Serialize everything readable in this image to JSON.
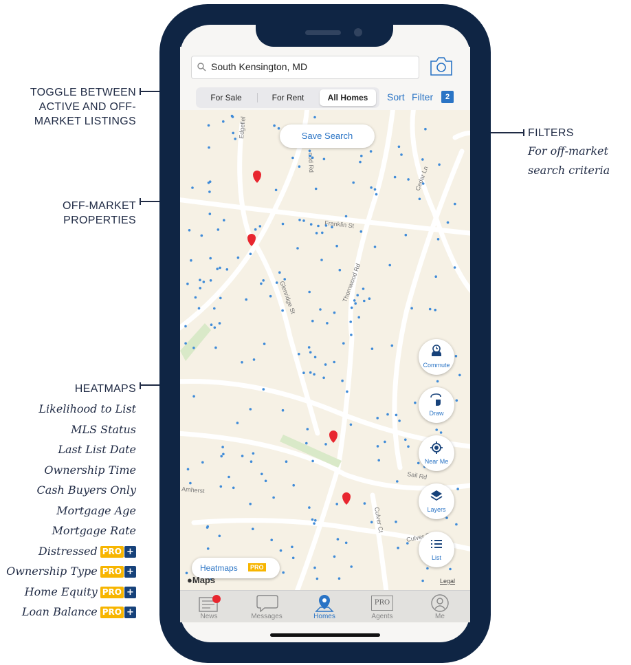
{
  "callouts": {
    "toggle": {
      "line1": "TOGGLE BETWEEN",
      "line2": "ACTIVE AND OFF-",
      "line3": "MARKET LISTINGS"
    },
    "filters": {
      "title": "FILTERS",
      "sub1": "For off-market",
      "sub2": "search criteria"
    },
    "offmarket": {
      "line1": "OFF-MARKET",
      "line2": "PROPERTIES"
    },
    "heatmaps": {
      "title": "HEATMAPS",
      "items": [
        "Likelihood to List",
        "MLS Status",
        "Last List Date",
        "Ownership Time",
        "Cash Buyers Only",
        "Mortgage Age",
        "Mortgage Rate",
        "Distressed",
        "Ownership Type",
        "Home Equity",
        "Loan Balance"
      ],
      "pro_label": "PRO",
      "plus_label": "+"
    }
  },
  "app": {
    "search": {
      "value": "South Kensington, MD"
    },
    "segments": [
      "For Sale",
      "For Rent",
      "All Homes"
    ],
    "active_segment": "All Homes",
    "sort_label": "Sort",
    "filter_label": "Filter",
    "filter_count": "2",
    "save_search_label": "Save Search",
    "streets": {
      "franklin": "Franklin St",
      "thornwood": "Thornwood Rd",
      "glenridge": "Glenridge St",
      "cedar": "Cedar Ln",
      "edgefield": "Edgefiel",
      "woodrd": "ood Rd",
      "amherst": "Amherst",
      "sailrd": "Sail Rd",
      "culver": "Culver S",
      "culverct": "Culver Ct"
    },
    "fabs": [
      "Commute",
      "Draw",
      "Near Me",
      "Layers",
      "List"
    ],
    "heatmaps_button": "Heatmaps",
    "heatmaps_badge": "PRO",
    "maps_logo": "Maps",
    "legal": "Legal",
    "tabs": [
      "News",
      "Messages",
      "Homes",
      "Agents",
      "Me"
    ],
    "active_tab": "Homes",
    "agents_icon_text": "PRO"
  },
  "colors": {
    "frame": "#0f2544",
    "accent": "#2a74c5",
    "pro": "#f7b500",
    "plus": "#17427a",
    "map_bg": "#f6f1e5",
    "dot": "#3f8bd8",
    "pin": "#e8262f"
  }
}
